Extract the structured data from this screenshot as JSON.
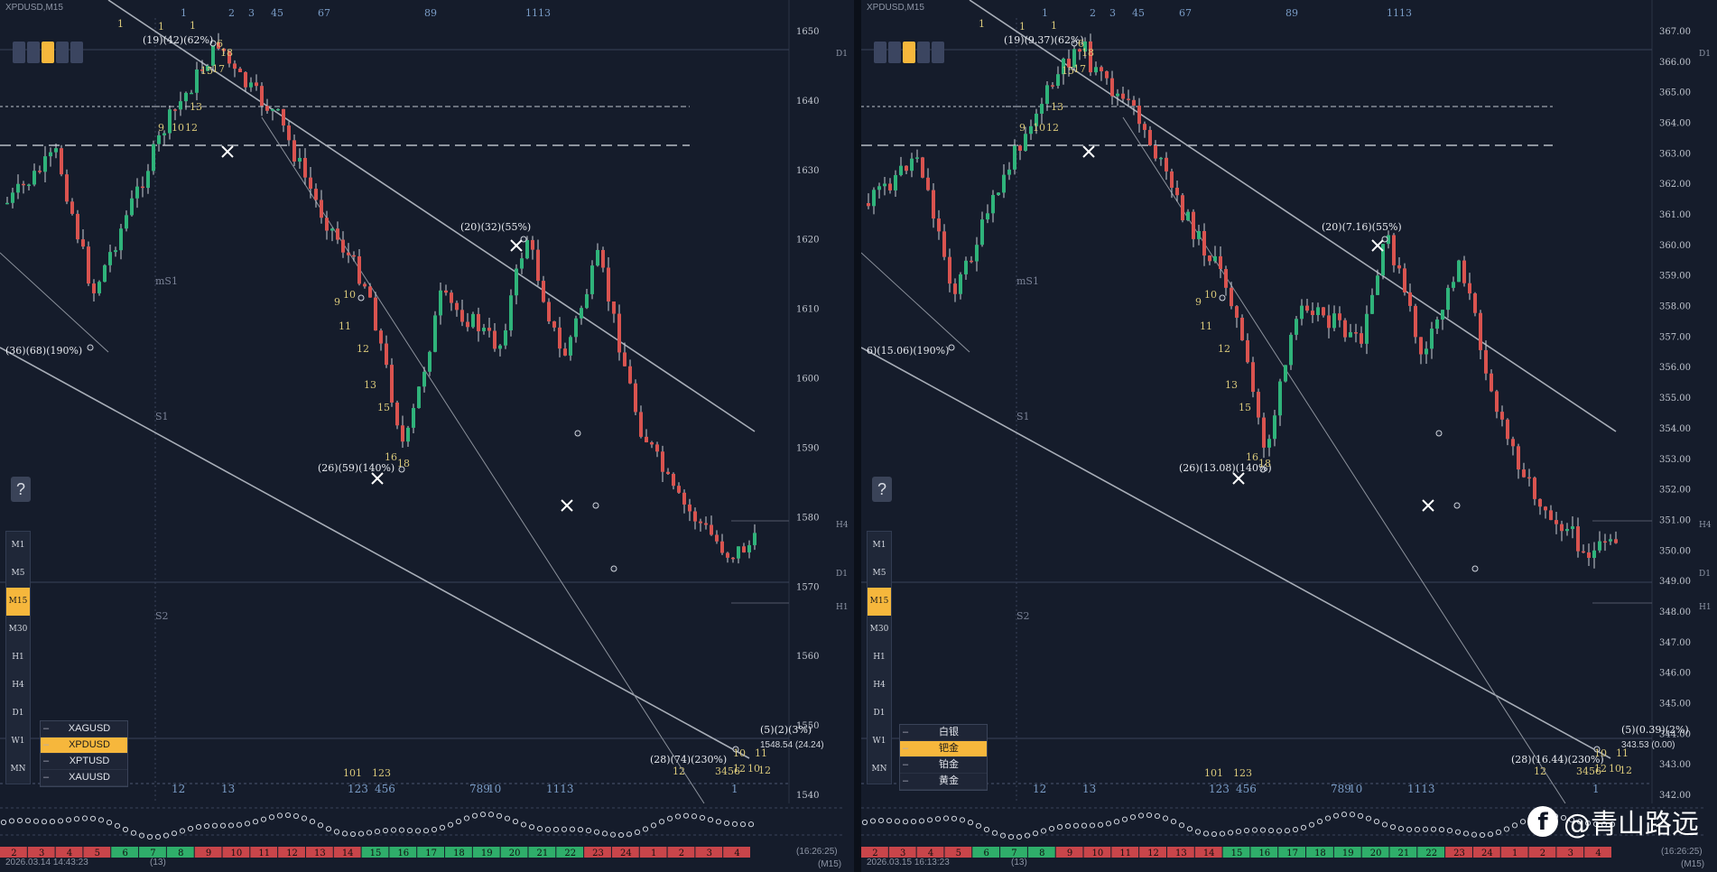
{
  "left_pane": {
    "title": "XPDUSD,M15",
    "help_label": "?",
    "timeframes": [
      "M1",
      "M5",
      "M15",
      "M30",
      "H1",
      "H4",
      "D1",
      "W1",
      "MN"
    ],
    "active_timeframe": "M15",
    "price_axis": [
      "1650",
      "1640",
      "1630",
      "1620",
      "1610",
      "1600",
      "1590",
      "1580",
      "1570",
      "1560",
      "1550",
      "1540"
    ],
    "price_tags": [
      "D1",
      "H4",
      "D1",
      "H1"
    ],
    "current_price": "1548.54 (24.24)",
    "symbol_list": [
      {
        "name": "XAGUSD",
        "active": false
      },
      {
        "name": "XPDUSD",
        "active": true
      },
      {
        "name": "XPTUSD",
        "active": false
      },
      {
        "name": "XAUUSD",
        "active": false
      }
    ],
    "zigzag_labels": [
      "(19)(42)(62%)",
      "(36)(68)(190%)",
      "(20)(32)(55%)",
      "(26)(59)(140%)",
      "(28)(74)(230%)",
      "(5)(2)(3%)"
    ],
    "levels": [
      "mS1",
      "S1",
      "S2"
    ],
    "top_ruler": [
      "1",
      "2",
      "3",
      "4",
      "5",
      "67",
      "8",
      "9",
      "10",
      "11",
      "12",
      "13"
    ],
    "bottom_ruler": [
      "12",
      "13",
      "123",
      "456",
      "789",
      "10",
      "11",
      "13",
      "1"
    ],
    "time_left": "2026.03.14 14:43:23",
    "time_right": "(16:26:25)",
    "bar_count": "(13)",
    "period_label": "(M15)"
  },
  "right_pane": {
    "title": "XPDUSD,M15",
    "help_label": "?",
    "timeframes": [
      "M1",
      "M5",
      "M15",
      "M30",
      "H1",
      "H4",
      "D1",
      "W1",
      "MN"
    ],
    "active_timeframe": "M15",
    "price_axis": [
      "367.00",
      "366.00",
      "365.00",
      "364.00",
      "363.00",
      "362.00",
      "361.00",
      "360.00",
      "359.00",
      "358.00",
      "357.00",
      "356.00",
      "355.00",
      "354.00",
      "353.00",
      "352.00",
      "351.00",
      "350.00",
      "349.00",
      "348.00",
      "347.00",
      "346.00",
      "345.00",
      "344.00",
      "343.00",
      "342.00"
    ],
    "price_tags": [
      "D1",
      "H4",
      "D1",
      "H1"
    ],
    "current_price": "343.53 (0.00)",
    "symbol_list": [
      {
        "name": "白银",
        "active": false
      },
      {
        "name": "钯金",
        "active": true
      },
      {
        "name": "铂金",
        "active": false
      },
      {
        "name": "黄金",
        "active": false
      }
    ],
    "zigzag_labels": [
      "(19)(9.37)(62%)",
      "6)(15.06)(190%)",
      "(20)(7.16)(55%)",
      "(26)(13.08)(140%)",
      "(28)(16.44)(230%)",
      "(5)(0.39)(2%)"
    ],
    "levels": [
      "mS1",
      "S1",
      "S2"
    ],
    "time_left": "2026.03.15 16:13:23",
    "time_right": "(16:26:25)",
    "bar_count": "(13)",
    "period_label": "(M15)"
  },
  "day_strip": [
    "2",
    "3",
    "4",
    "5",
    "6",
    "7",
    "8",
    "9",
    "10",
    "11",
    "12",
    "13",
    "14",
    "15",
    "16",
    "17",
    "18",
    "19",
    "20",
    "21",
    "22",
    "23",
    "24",
    "1",
    "2",
    "3",
    "4"
  ],
  "watermark": {
    "text": "@青山路远",
    "icon": "facebook-icon"
  },
  "colors": {
    "bull": "#2fb37a",
    "bear": "#d9534f",
    "accent": "#f6b73c",
    "bg": "#151c2b"
  }
}
